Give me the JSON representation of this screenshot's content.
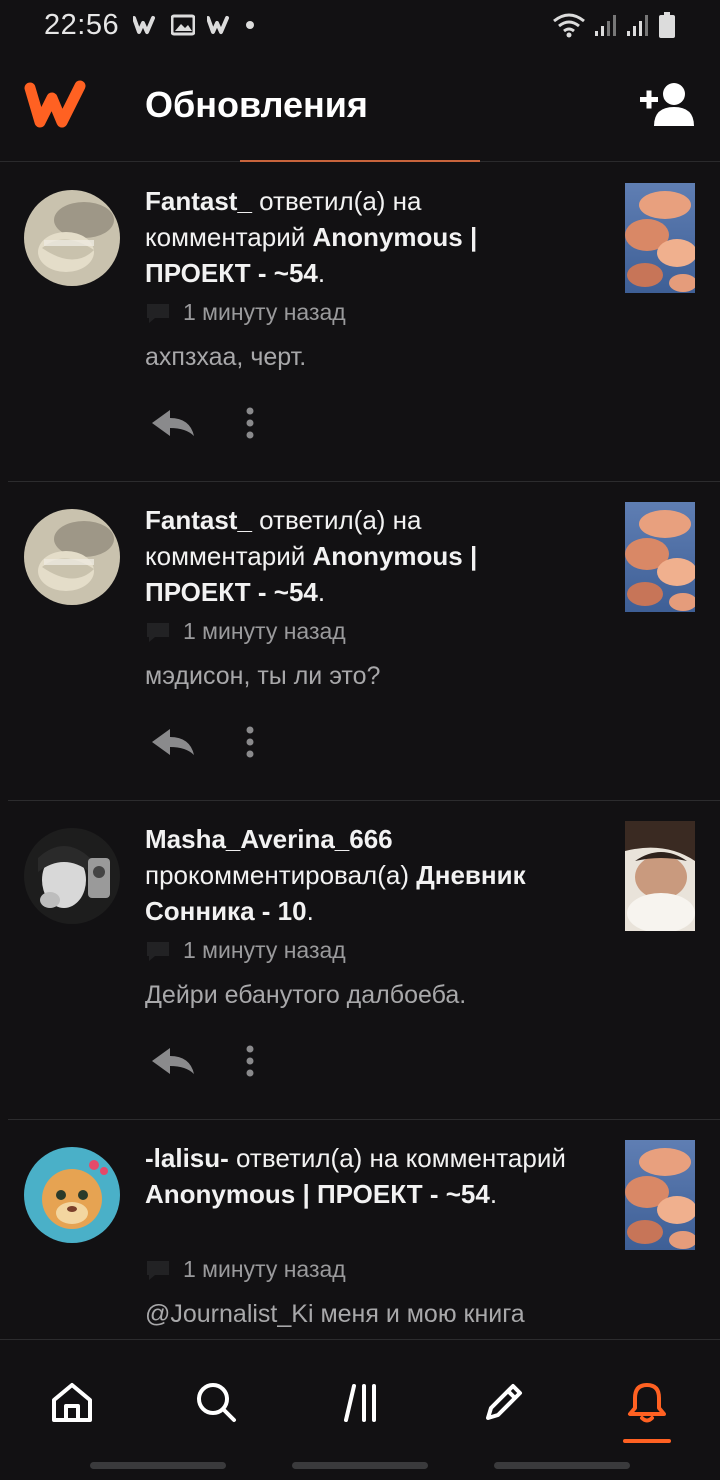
{
  "status_bar": {
    "time": "22:56",
    "left_icons": [
      "wattpad-w-icon",
      "image-icon",
      "wattpad-w-icon",
      "dot-icon"
    ],
    "right_icons": [
      "wifi-icon",
      "signal-icon",
      "signal-icon",
      "battery-icon"
    ]
  },
  "app_bar": {
    "title": "Обновления",
    "logo_icon": "wattpad-logo-icon",
    "action_icon": "add-user-icon"
  },
  "colors": {
    "accent": "#ff6122",
    "background": "#121113",
    "divider": "#2c2c2e"
  },
  "notifications": [
    {
      "user": "Fantast_",
      "action": "ответил(а) на комментарий",
      "story": "Anonymous | ПРОЕКТ - ~54",
      "time": "1 минуту назад",
      "comment": "ахпзхаа, черт."
    },
    {
      "user": "Fantast_",
      "action": "ответил(а) на комментарий",
      "story": "Anonymous | ПРОЕКТ - ~54",
      "time": "1 минуту назад",
      "comment": "мэдисон, ты ли это?"
    },
    {
      "user": "Masha_Averina_666",
      "action": "прокомментировал(а)",
      "story": "Дневник Сонника - 10",
      "time": "1 минуту назад",
      "comment": "Дейри ебанутого далбоеба."
    },
    {
      "user": "-lalisu-",
      "action": "ответил(а) на комментарий",
      "story": "Anonymous | ПРОЕКТ - ~54",
      "time": "1 минуту назад",
      "comment": "@Journalist_Ki меня и мою книга"
    }
  ],
  "bottom_nav": [
    {
      "name": "home",
      "icon": "home-icon"
    },
    {
      "name": "search",
      "icon": "search-icon"
    },
    {
      "name": "library",
      "icon": "library-icon"
    },
    {
      "name": "write",
      "icon": "pencil-icon"
    },
    {
      "name": "notifications",
      "icon": "bell-icon",
      "active": true
    }
  ]
}
